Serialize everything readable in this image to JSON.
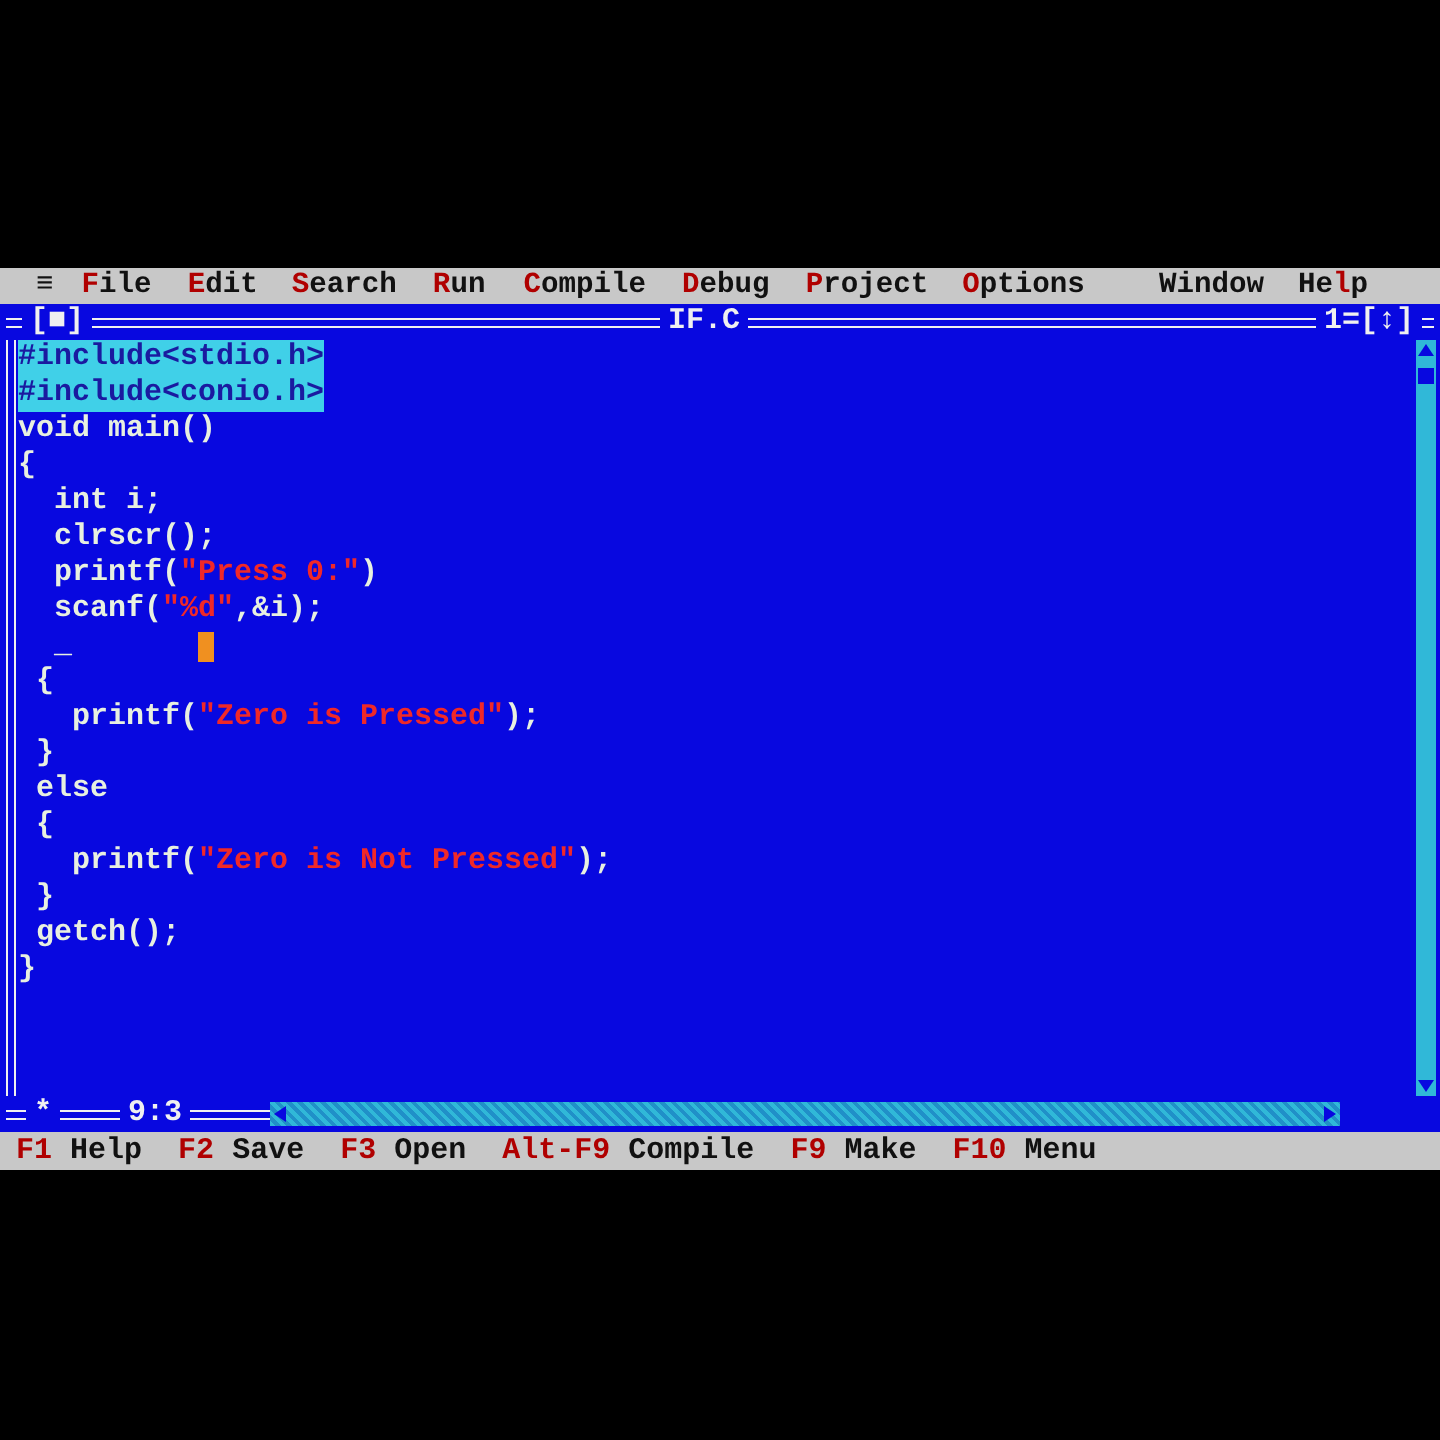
{
  "menu_bar": {
    "items": [
      {
        "parts": [
          {
            "text": "≡",
            "hot": false
          }
        ]
      },
      {
        "parts": [
          {
            "text": "F",
            "hot": true
          },
          {
            "text": "ile",
            "hot": false
          }
        ]
      },
      {
        "parts": [
          {
            "text": "E",
            "hot": true
          },
          {
            "text": "dit",
            "hot": false
          }
        ]
      },
      {
        "parts": [
          {
            "text": "S",
            "hot": true
          },
          {
            "text": "earch",
            "hot": false
          }
        ]
      },
      {
        "parts": [
          {
            "text": "R",
            "hot": true
          },
          {
            "text": "un",
            "hot": false
          }
        ]
      },
      {
        "parts": [
          {
            "text": "C",
            "hot": true
          },
          {
            "text": "ompile",
            "hot": false
          }
        ]
      },
      {
        "parts": [
          {
            "text": "D",
            "hot": true
          },
          {
            "text": "ebug",
            "hot": false
          }
        ]
      },
      {
        "parts": [
          {
            "text": "P",
            "hot": true
          },
          {
            "text": "roject",
            "hot": false
          }
        ]
      },
      {
        "parts": [
          {
            "text": "O",
            "hot": true
          },
          {
            "text": "ptions",
            "hot": false
          }
        ]
      },
      {
        "parts": [
          {
            "text": "Window",
            "hot": false
          }
        ]
      },
      {
        "parts": [
          {
            "text": "He",
            "hot": false
          },
          {
            "text": "l",
            "hot": true
          },
          {
            "text": "p",
            "hot": false
          }
        ]
      }
    ]
  },
  "editor": {
    "close_box": "[■]",
    "title": "IF.C",
    "window_number": "1=[↕]",
    "modified_marker": "*",
    "position": "9:3",
    "lines": [
      {
        "cursor": false,
        "segments": [
          {
            "text": "#include<stdio.h>",
            "kind": "highlight"
          }
        ]
      },
      {
        "cursor": false,
        "segments": [
          {
            "text": "#include<conio.h>",
            "kind": "highlight"
          }
        ]
      },
      {
        "cursor": false,
        "segments": [
          {
            "text": "void main()",
            "kind": "plain"
          }
        ]
      },
      {
        "cursor": false,
        "segments": [
          {
            "text": "{",
            "kind": "plain"
          }
        ]
      },
      {
        "cursor": false,
        "segments": [
          {
            "text": "  int i;",
            "kind": "plain"
          }
        ]
      },
      {
        "cursor": false,
        "segments": [
          {
            "text": "  clrscr();",
            "kind": "plain"
          }
        ]
      },
      {
        "cursor": false,
        "segments": [
          {
            "text": "  printf(",
            "kind": "plain"
          },
          {
            "text": "\"Press 0:\"",
            "kind": "string"
          },
          {
            "text": ")",
            "kind": "plain"
          }
        ]
      },
      {
        "cursor": false,
        "segments": [
          {
            "text": "  scanf(",
            "kind": "plain"
          },
          {
            "text": "\"%d\"",
            "kind": "string"
          },
          {
            "text": ",&i);",
            "kind": "plain"
          }
        ]
      },
      {
        "cursor": true,
        "segments": [
          {
            "text": "  _",
            "kind": "plain"
          }
        ]
      },
      {
        "cursor": false,
        "segments": [
          {
            "text": " {",
            "kind": "plain"
          }
        ]
      },
      {
        "cursor": false,
        "segments": [
          {
            "text": "   printf(",
            "kind": "plain"
          },
          {
            "text": "\"Zero is Pressed\"",
            "kind": "string"
          },
          {
            "text": ");",
            "kind": "plain"
          }
        ]
      },
      {
        "cursor": false,
        "segments": [
          {
            "text": " }",
            "kind": "plain"
          }
        ]
      },
      {
        "cursor": false,
        "segments": [
          {
            "text": " else",
            "kind": "plain"
          }
        ]
      },
      {
        "cursor": false,
        "segments": [
          {
            "text": " {",
            "kind": "plain"
          }
        ]
      },
      {
        "cursor": false,
        "segments": [
          {
            "text": "   printf(",
            "kind": "plain"
          },
          {
            "text": "\"Zero is Not Pressed\"",
            "kind": "string"
          },
          {
            "text": ");",
            "kind": "plain"
          }
        ]
      },
      {
        "cursor": false,
        "segments": [
          {
            "text": " }",
            "kind": "plain"
          }
        ]
      },
      {
        "cursor": false,
        "segments": [
          {
            "text": " getch();",
            "kind": "plain"
          }
        ]
      },
      {
        "cursor": false,
        "segments": [
          {
            "text": "}",
            "kind": "plain"
          }
        ]
      }
    ]
  },
  "status_bar": {
    "items": [
      {
        "key": "F1",
        "label": "Help"
      },
      {
        "key": "F2",
        "label": "Save"
      },
      {
        "key": "F3",
        "label": "Open"
      },
      {
        "key": "Alt-F9",
        "label": "Compile"
      },
      {
        "key": "F9",
        "label": "Make"
      },
      {
        "key": "F10",
        "label": "Menu"
      }
    ]
  }
}
